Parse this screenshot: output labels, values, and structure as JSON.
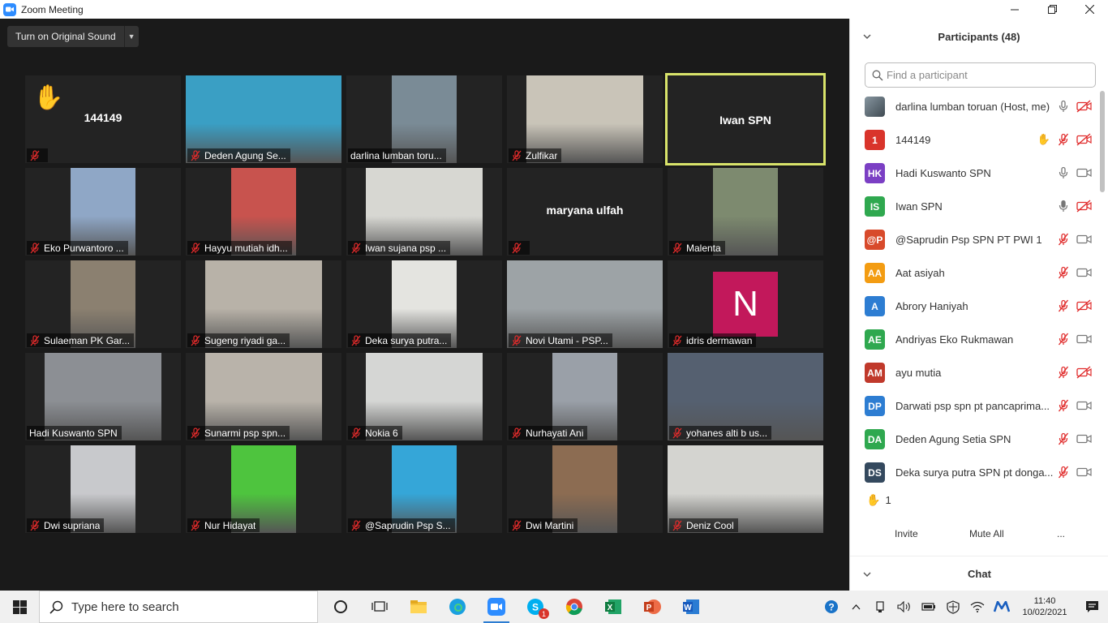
{
  "window": {
    "title": "Zoom Meeting"
  },
  "meeting": {
    "original_sound_label": "Turn on Original Sound",
    "tiles": [
      {
        "name": "144149",
        "kind": "name",
        "hand": true,
        "bg": "#232323"
      },
      {
        "name": "Deden Agung Se...",
        "kind": "video",
        "bg": "#3a9fc4",
        "vx": 0,
        "vw": 192
      },
      {
        "name": "darlina lumban toru...",
        "kind": "video",
        "bg": "#7a8b96",
        "vx": 56,
        "vw": 80,
        "nomic": true
      },
      {
        "name": "Zulfikar",
        "kind": "video",
        "bg": "#c9c4b8",
        "vx": 24,
        "vw": 144
      },
      {
        "name": "Iwan SPN",
        "kind": "name",
        "active": true,
        "bg": "#232323"
      },
      {
        "name": "Eko Purwantoro ...",
        "kind": "video",
        "bg": "#8fa7c6",
        "vx": 56,
        "vw": 80
      },
      {
        "name": "Hayyu mutiah idh...",
        "kind": "video",
        "bg": "#c8534e",
        "vx": 56,
        "vw": 80
      },
      {
        "name": "Iwan sujana psp ...",
        "kind": "video",
        "bg": "#d7d7d2",
        "vx": 24,
        "vw": 144
      },
      {
        "name": "maryana ulfah",
        "kind": "name",
        "bg": "#232323"
      },
      {
        "name": "Malenta",
        "kind": "video",
        "bg": "#7d8a6f",
        "vx": 56,
        "vw": 80
      },
      {
        "name": "Sulaeman PK Gar...",
        "kind": "video",
        "bg": "#8b8070",
        "vx": 56,
        "vw": 80
      },
      {
        "name": "Sugeng riyadi ga...",
        "kind": "video",
        "bg": "#b8b2a8",
        "vx": 24,
        "vw": 144
      },
      {
        "name": "Deka surya putra...",
        "kind": "video",
        "bg": "#e4e4e0",
        "vx": 56,
        "vw": 80
      },
      {
        "name": "Novi Utami - PSP...",
        "kind": "video",
        "bg": "#9da3a6",
        "vx": 0,
        "vw": 192
      },
      {
        "name": "idris dermawan",
        "kind": "avatar",
        "letter": "N",
        "bg": "#232323"
      },
      {
        "name": "Hadi Kuswanto SPN",
        "kind": "video",
        "bg": "#8c8f94",
        "vx": 24,
        "vw": 144,
        "nomic": true
      },
      {
        "name": "Sunarmi psp spn...",
        "kind": "video",
        "bg": "#b9b3aa",
        "vx": 24,
        "vw": 144
      },
      {
        "name": "Nokia 6",
        "kind": "video",
        "bg": "#d5d6d4",
        "vx": 24,
        "vw": 144
      },
      {
        "name": "Nurhayati Ani",
        "kind": "video",
        "bg": "#9aa0a8",
        "vx": 56,
        "vw": 80
      },
      {
        "name": "yohanes alti b us...",
        "kind": "video",
        "bg": "#556070",
        "vx": 0,
        "vw": 192
      },
      {
        "name": "Dwi supriana",
        "kind": "video",
        "bg": "#c8c9cc",
        "vx": 56,
        "vw": 80
      },
      {
        "name": "Nur Hidayat",
        "kind": "video",
        "bg": "#4ec43e",
        "vx": 56,
        "vw": 80
      },
      {
        "name": "@Saprudin Psp S...",
        "kind": "video",
        "bg": "#35a6d8",
        "vx": 56,
        "vw": 80
      },
      {
        "name": "Dwi Martini",
        "kind": "video",
        "bg": "#8c6c52",
        "vx": 56,
        "vw": 80
      },
      {
        "name": "Deniz Cool",
        "kind": "video",
        "bg": "#d4d4d0",
        "vx": 0,
        "vw": 192
      }
    ]
  },
  "panel": {
    "title": "Participants (48)",
    "search_placeholder": "Find a participant",
    "participants": [
      {
        "initials": "",
        "name": "darlina lumban toruan (Host, me)",
        "color": "#6b7a85",
        "photo": true,
        "hand": false,
        "mic": "on",
        "cam": "off"
      },
      {
        "initials": "1",
        "name": "144149",
        "color": "#d9342b",
        "hand": true,
        "mic": "off",
        "cam": "off"
      },
      {
        "initials": "HK",
        "name": "Hadi Kuswanto SPN",
        "color": "#7b3fc4",
        "hand": false,
        "mic": "on",
        "cam": "on"
      },
      {
        "initials": "IS",
        "name": "Iwan SPN",
        "color": "#2fa84f",
        "hand": false,
        "mic": "speaking",
        "cam": "off"
      },
      {
        "initials": "@P",
        "name": "@Saprudin Psp SPN PT PWI 1",
        "color": "#d84a2b",
        "hand": false,
        "mic": "off",
        "cam": "on"
      },
      {
        "initials": "AA",
        "name": "Aat asiyah",
        "color": "#f39c12",
        "hand": false,
        "mic": "off",
        "cam": "on"
      },
      {
        "initials": "A",
        "name": "Abrory Haniyah",
        "color": "#2d7dd2",
        "hand": false,
        "mic": "off",
        "cam": "off"
      },
      {
        "initials": "AE",
        "name": "Andriyas Eko Rukmawan",
        "color": "#2fa84f",
        "hand": false,
        "mic": "off",
        "cam": "on"
      },
      {
        "initials": "AM",
        "name": "ayu mutia",
        "color": "#c0392b",
        "hand": false,
        "mic": "off",
        "cam": "off"
      },
      {
        "initials": "DP",
        "name": "Darwati psp spn pt pancaprima...",
        "color": "#2d7dd2",
        "hand": false,
        "mic": "off",
        "cam": "on"
      },
      {
        "initials": "DA",
        "name": "Deden Agung Setia SPN",
        "color": "#2fa84f",
        "hand": false,
        "mic": "off",
        "cam": "on"
      },
      {
        "initials": "DS",
        "name": "Deka surya putra SPN pt donga...",
        "color": "#34495e",
        "hand": false,
        "mic": "off",
        "cam": "on"
      }
    ],
    "raised_hands": "1",
    "invite_label": "Invite",
    "mute_all_label": "Mute All",
    "more_label": "...",
    "chat_label": "Chat"
  },
  "taskbar": {
    "search_placeholder": "Type here to search",
    "time": "11:40",
    "date": "10/02/2021",
    "skype_badge": "1"
  }
}
